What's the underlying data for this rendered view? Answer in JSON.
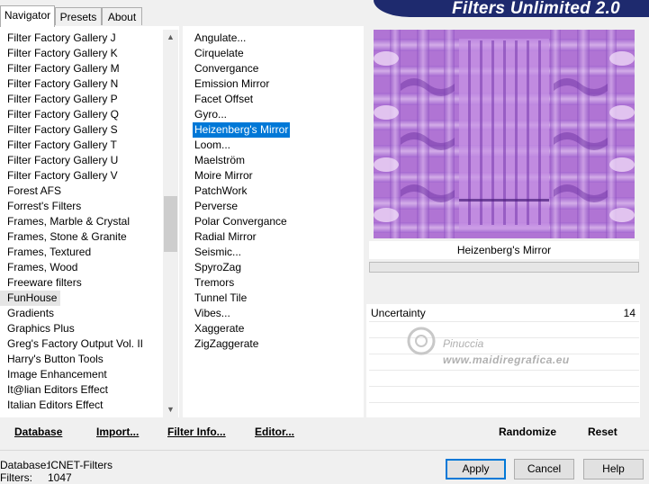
{
  "tabs": [
    "Navigator",
    "Presets",
    "About"
  ],
  "app_title": "Filters Unlimited 2.0",
  "categories": [
    "Filter Factory Gallery J",
    "Filter Factory Gallery K",
    "Filter Factory Gallery M",
    "Filter Factory Gallery N",
    "Filter Factory Gallery P",
    "Filter Factory Gallery Q",
    "Filter Factory Gallery S",
    "Filter Factory Gallery T",
    "Filter Factory Gallery U",
    "Filter Factory Gallery V",
    "Forest AFS",
    "Forrest's Filters",
    "Frames, Marble & Crystal",
    "Frames, Stone & Granite",
    "Frames, Textured",
    "Frames, Wood",
    "Freeware filters",
    "FunHouse",
    "Gradients",
    "Graphics Plus",
    "Greg's Factory Output Vol. II",
    "Harry's Button Tools",
    "Image Enhancement",
    "It@lian Editors Effect",
    "Italian Editors Effect"
  ],
  "selected_category": "FunHouse",
  "filters": [
    "Angulate...",
    "Cirquelate",
    "Convergance",
    "Emission Mirror",
    "Facet Offset",
    "Gyro...",
    "Heizenberg's Mirror",
    "Loom...",
    "Maelström",
    "Moire Mirror",
    "PatchWork",
    "Perverse",
    "Polar Convergance",
    "Radial Mirror",
    "Seismic...",
    "SpyroZag",
    "Tremors",
    "Tunnel Tile",
    "Vibes...",
    "Xaggerate",
    "ZigZaggerate"
  ],
  "selected_filter": "Heizenberg's Mirror",
  "preview_caption": "Heizenberg's Mirror",
  "parameter": {
    "name": "Uncertainty",
    "value": "14"
  },
  "watermark": {
    "line1": "Pinuccia",
    "line2": "www.maidiregrafica.eu"
  },
  "bottom_links": [
    "Database",
    "Import...",
    "Filter Info...",
    "Editor..."
  ],
  "right_links": [
    "Randomize",
    "Reset"
  ],
  "status": {
    "database_label": "Database:",
    "database_value": "ICNET-Filters",
    "filters_label": "Filters:",
    "filters_value": "1047"
  },
  "buttons": [
    "Apply",
    "Cancel",
    "Help"
  ],
  "colors": {
    "selection": "#0078d7",
    "banner": "#1e2a6e",
    "preview": "#b377d6"
  }
}
